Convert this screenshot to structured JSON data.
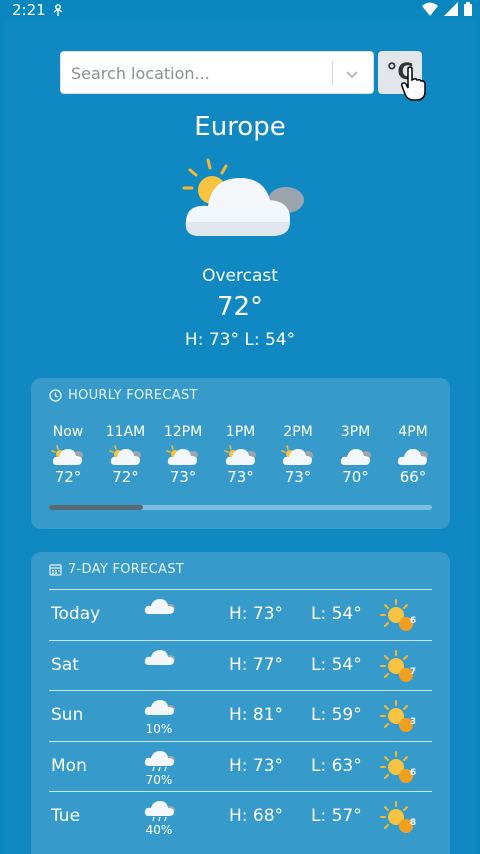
{
  "status": {
    "time": "2:21"
  },
  "search": {
    "placeholder": "Search location...",
    "unit_label": "°C"
  },
  "current": {
    "location": "Europe",
    "condition": "Overcast",
    "temp": "72°",
    "hilo": "H: 73°  L: 54°",
    "icon": "cloud-sun-icon"
  },
  "hourly": {
    "title": "HOURLY FORECAST",
    "items": [
      {
        "time": "Now",
        "temp": "72°",
        "icon": "partly-cloudy-icon"
      },
      {
        "time": "11AM",
        "temp": "72°",
        "icon": "partly-cloudy-icon"
      },
      {
        "time": "12PM",
        "temp": "73°",
        "icon": "partly-cloudy-icon"
      },
      {
        "time": "1PM",
        "temp": "73°",
        "icon": "partly-cloudy-icon"
      },
      {
        "time": "2PM",
        "temp": "73°",
        "icon": "partly-cloudy-icon"
      },
      {
        "time": "3PM",
        "temp": "70°",
        "icon": "cloud-icon"
      },
      {
        "time": "4PM",
        "temp": "66°",
        "icon": "cloud-icon"
      }
    ],
    "scroll_position": 0.25
  },
  "daily": {
    "title": "7-DAY FORECAST",
    "items": [
      {
        "day": "Today",
        "precip": "",
        "high": "H: 73°",
        "low": "L: 54°",
        "uv": "6",
        "icon": "cloud-icon"
      },
      {
        "day": "Sat",
        "precip": "",
        "high": "H: 77°",
        "low": "L: 54°",
        "uv": "7",
        "icon": "cloud-icon"
      },
      {
        "day": "Sun",
        "precip": "10%",
        "high": "H: 81°",
        "low": "L: 59°",
        "uv": "3",
        "icon": "cloud-icon"
      },
      {
        "day": "Mon",
        "precip": "70%",
        "high": "H: 73°",
        "low": "L: 63°",
        "uv": "6",
        "icon": "rain-cloud-icon"
      },
      {
        "day": "Tue",
        "precip": "40%",
        "high": "H: 68°",
        "low": "L: 57°",
        "uv": "8",
        "icon": "rain-cloud-icon"
      }
    ]
  },
  "colors": {
    "background": "#0a86bf",
    "card": "rgba(255,255,255,0.16)",
    "uv_badge": "#f0a020"
  }
}
